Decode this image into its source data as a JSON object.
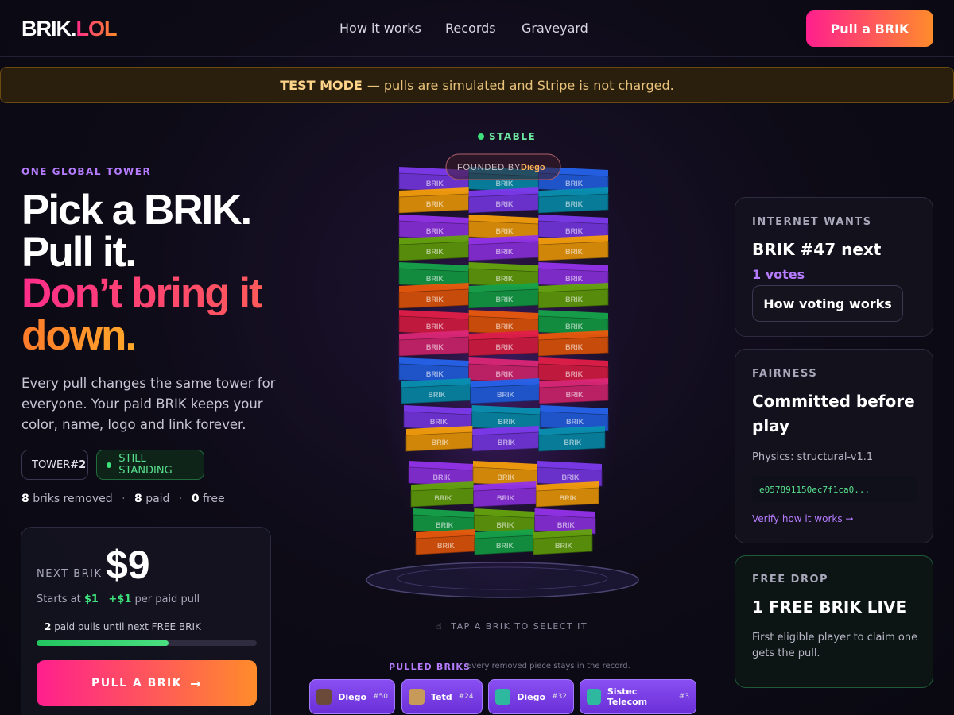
{
  "nav": {
    "logo_a": "BRIK.",
    "logo_b": "LOL",
    "links": [
      "How it works",
      "Records",
      "Graveyard"
    ],
    "cta": "Pull a BRIK"
  },
  "banner": {
    "strong": "TEST MODE",
    "text": "— pulls are simulated and Stripe is not charged."
  },
  "hero": {
    "eyebrow": "ONE GLOBAL TOWER",
    "line1": "Pick a BRIK.",
    "line2": "Pull it.",
    "line3": "Don’t bring it",
    "line4": "down.",
    "lead": "Every pull changes the same tower for everyone. Your paid BRIK keeps your color, name, logo and link forever.",
    "tower_chip_prefix": "TOWER ",
    "tower_chip_num": "#2",
    "status_chip": "STILL STANDING",
    "stats": {
      "removed": "8",
      "removed_label": "briks removed",
      "paid": "8",
      "paid_label": "paid",
      "free": "0",
      "free_label": "free"
    }
  },
  "price_card": {
    "label": "NEXT BRIK",
    "price": "$9",
    "starts_prefix": "Starts at",
    "start_price": "$1",
    "increment": "+$1",
    "increment_suffix": "per paid pull",
    "pulls_until_num": "2",
    "pulls_until_text": "paid pulls until next FREE BRIK",
    "progress": 0.6,
    "button": "PULL A BRIK",
    "button_arrow": "→"
  },
  "tower": {
    "status": "STABLE",
    "founded_prefix": "FOUNDED BY",
    "founded_name": "Diego",
    "brick_label": "BRIK",
    "tap_hint": "TAP A BRIK TO SELECT IT",
    "pulled_label": "PULLED BRIKS",
    "pulled_sub": "Every removed piece stays in the record.",
    "pulled": [
      {
        "name": "Diego",
        "num": "#50",
        "thumb_color": "#6b4a3a"
      },
      {
        "name": "Tetd",
        "num": "#24",
        "thumb_color": "#c89a5a"
      },
      {
        "name": "Diego",
        "num": "#32",
        "thumb_color": "#2fb8a0"
      },
      {
        "name": "Sistec Telecom",
        "num": "#3",
        "thumb_color": "#2fb8a0"
      }
    ]
  },
  "internet_wants": {
    "caption": "INTERNET WANTS",
    "title": "BRIK #47 next",
    "votes": "1 votes",
    "button": "How voting works"
  },
  "fairness": {
    "caption": "FAIRNESS",
    "title_line1": "Committed before",
    "title_line2": "play",
    "physics": "Physics: structural-v1.1",
    "hash": "e057891150ec7f1ca0...",
    "verify": "Verify how it works →"
  },
  "free_drop": {
    "caption": "FREE DROP",
    "title": "1 FREE BRIK LIVE",
    "desc": "First eligible player to claim one gets the pull."
  },
  "colors": {
    "accent_pink": "#ff1f8e",
    "accent_orange": "#ff8c2b",
    "purple": "#b57cff",
    "green": "#3de07a"
  }
}
